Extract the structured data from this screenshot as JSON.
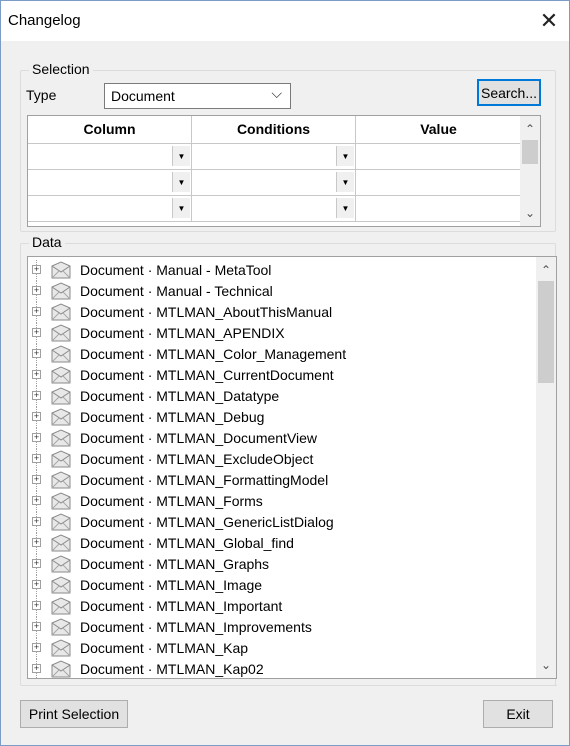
{
  "window": {
    "title": "Changelog",
    "close_glyph": "✕"
  },
  "selection": {
    "legend": "Selection",
    "type_label": "Type",
    "type_value": "Document",
    "search_label": "Search...",
    "columns": [
      "Column",
      "Conditions",
      "Value"
    ],
    "rows": [
      {
        "column": "",
        "condition": "",
        "value": ""
      },
      {
        "column": "",
        "condition": "",
        "value": ""
      },
      {
        "column": "",
        "condition": "",
        "value": ""
      }
    ]
  },
  "data": {
    "legend": "Data",
    "items": [
      "Document · Manual - MetaTool",
      "Document · Manual - Technical",
      "Document · MTLMAN_AboutThisManual",
      "Document · MTLMAN_APENDIX",
      "Document · MTLMAN_Color_Management",
      "Document · MTLMAN_CurrentDocument",
      "Document · MTLMAN_Datatype",
      "Document · MTLMAN_Debug",
      "Document · MTLMAN_DocumentView",
      "Document · MTLMAN_ExcludeObject",
      "Document · MTLMAN_FormattingModel",
      "Document · MTLMAN_Forms",
      "Document · MTLMAN_GenericListDialog",
      "Document · MTLMAN_Global_find",
      "Document · MTLMAN_Graphs",
      "Document · MTLMAN_Image",
      "Document · MTLMAN_Important",
      "Document · MTLMAN_Improvements",
      "Document · MTLMAN_Kap",
      "Document · MTLMAN_Kap02"
    ]
  },
  "footer": {
    "print_label": "Print Selection",
    "exit_label": "Exit"
  },
  "colors": {
    "focus_border": "#0078d7",
    "window_bg": "#f0f0f0"
  }
}
